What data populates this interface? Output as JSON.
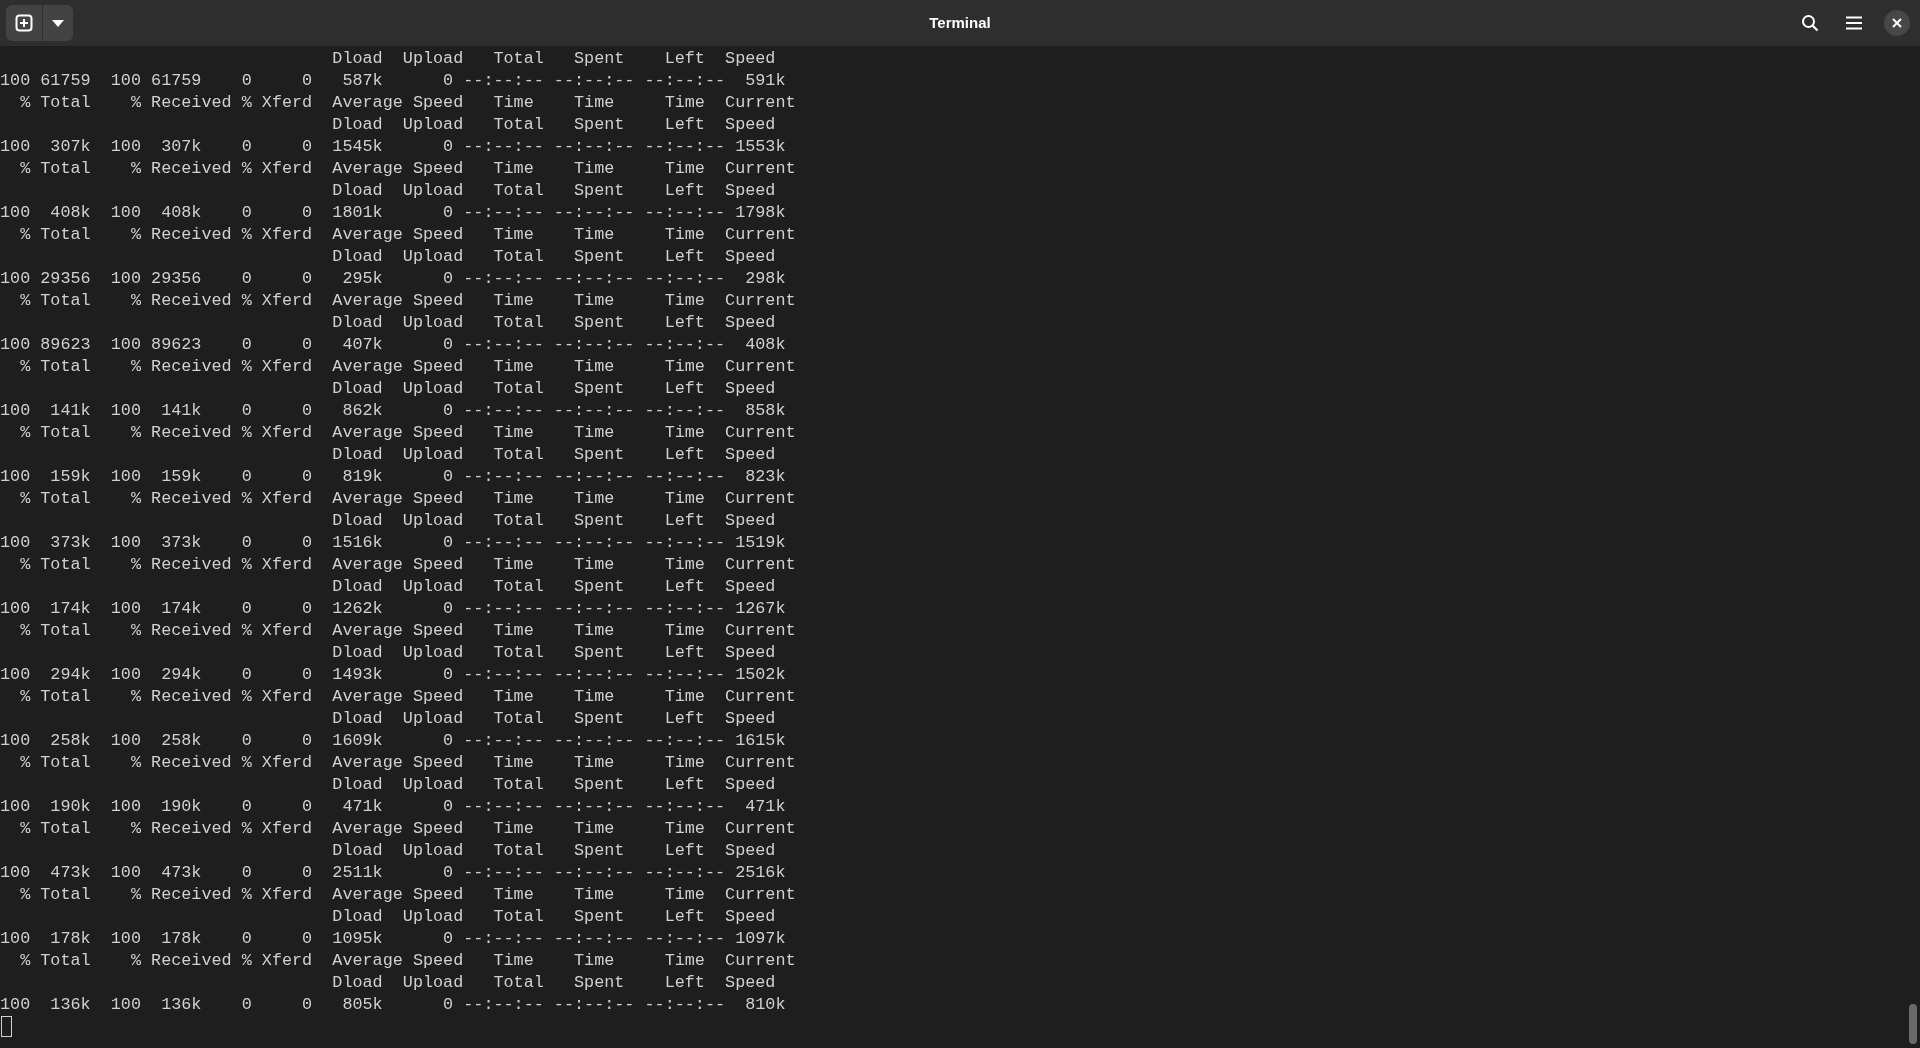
{
  "window": {
    "title": "Terminal"
  },
  "terminal": {
    "lines": [
      "                                 Dload  Upload   Total   Spent    Left  Speed",
      "100 61759  100 61759    0     0   587k      0 --:--:-- --:--:-- --:--:--  591k",
      "  % Total    % Received % Xferd  Average Speed   Time    Time     Time  Current",
      "                                 Dload  Upload   Total   Spent    Left  Speed",
      "100  307k  100  307k    0     0  1545k      0 --:--:-- --:--:-- --:--:-- 1553k",
      "  % Total    % Received % Xferd  Average Speed   Time    Time     Time  Current",
      "                                 Dload  Upload   Total   Spent    Left  Speed",
      "100  408k  100  408k    0     0  1801k      0 --:--:-- --:--:-- --:--:-- 1798k",
      "  % Total    % Received % Xferd  Average Speed   Time    Time     Time  Current",
      "                                 Dload  Upload   Total   Spent    Left  Speed",
      "100 29356  100 29356    0     0   295k      0 --:--:-- --:--:-- --:--:--  298k",
      "  % Total    % Received % Xferd  Average Speed   Time    Time     Time  Current",
      "                                 Dload  Upload   Total   Spent    Left  Speed",
      "100 89623  100 89623    0     0   407k      0 --:--:-- --:--:-- --:--:--  408k",
      "  % Total    % Received % Xferd  Average Speed   Time    Time     Time  Current",
      "                                 Dload  Upload   Total   Spent    Left  Speed",
      "100  141k  100  141k    0     0   862k      0 --:--:-- --:--:-- --:--:--  858k",
      "  % Total    % Received % Xferd  Average Speed   Time    Time     Time  Current",
      "                                 Dload  Upload   Total   Spent    Left  Speed",
      "100  159k  100  159k    0     0   819k      0 --:--:-- --:--:-- --:--:--  823k",
      "  % Total    % Received % Xferd  Average Speed   Time    Time     Time  Current",
      "                                 Dload  Upload   Total   Spent    Left  Speed",
      "100  373k  100  373k    0     0  1516k      0 --:--:-- --:--:-- --:--:-- 1519k",
      "  % Total    % Received % Xferd  Average Speed   Time    Time     Time  Current",
      "                                 Dload  Upload   Total   Spent    Left  Speed",
      "100  174k  100  174k    0     0  1262k      0 --:--:-- --:--:-- --:--:-- 1267k",
      "  % Total    % Received % Xferd  Average Speed   Time    Time     Time  Current",
      "                                 Dload  Upload   Total   Spent    Left  Speed",
      "100  294k  100  294k    0     0  1493k      0 --:--:-- --:--:-- --:--:-- 1502k",
      "  % Total    % Received % Xferd  Average Speed   Time    Time     Time  Current",
      "                                 Dload  Upload   Total   Spent    Left  Speed",
      "100  258k  100  258k    0     0  1609k      0 --:--:-- --:--:-- --:--:-- 1615k",
      "  % Total    % Received % Xferd  Average Speed   Time    Time     Time  Current",
      "                                 Dload  Upload   Total   Spent    Left  Speed",
      "100  190k  100  190k    0     0   471k      0 --:--:-- --:--:-- --:--:--  471k",
      "  % Total    % Received % Xferd  Average Speed   Time    Time     Time  Current",
      "                                 Dload  Upload   Total   Spent    Left  Speed",
      "100  473k  100  473k    0     0  2511k      0 --:--:-- --:--:-- --:--:-- 2516k",
      "  % Total    % Received % Xferd  Average Speed   Time    Time     Time  Current",
      "                                 Dload  Upload   Total   Spent    Left  Speed",
      "100  178k  100  178k    0     0  1095k      0 --:--:-- --:--:-- --:--:-- 1097k",
      "  % Total    % Received % Xferd  Average Speed   Time    Time     Time  Current",
      "                                 Dload  Upload   Total   Spent    Left  Speed",
      "100  136k  100  136k    0     0   805k      0 --:--:-- --:--:-- --:--:--  810k"
    ]
  }
}
